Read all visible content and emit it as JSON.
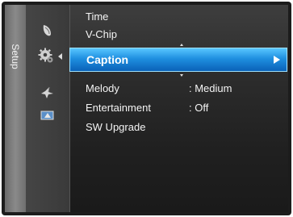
{
  "side_tab": {
    "label": "Setup"
  },
  "icons": {
    "picture": "picture-icon",
    "setup": "setup-gear-icon",
    "sound": "sound-icon",
    "input": "input-icon"
  },
  "menu": {
    "items": [
      {
        "label": "Time",
        "value": ""
      },
      {
        "label": "V-Chip",
        "value": ""
      },
      {
        "label": "Caption",
        "value": "",
        "selected": true
      },
      {
        "label": "Melody",
        "value": ": Medium"
      },
      {
        "label": "Entertainment",
        "value": ": Off"
      },
      {
        "label": "SW Upgrade",
        "value": ""
      }
    ]
  },
  "colors": {
    "highlight": "#1f8fe0",
    "background": "#2a2a2a",
    "text": "#f4f4f4"
  }
}
